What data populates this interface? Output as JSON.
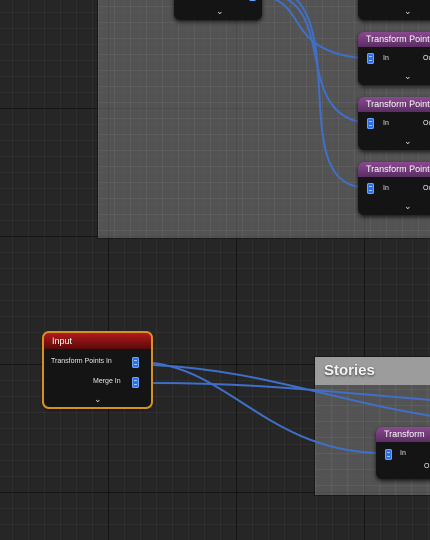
{
  "canvas": {
    "grid_color": "#262626",
    "wire_color": "#3f6fc8"
  },
  "top_comment": {
    "title": ""
  },
  "top_nodes": [
    {
      "title": "Transform Points",
      "in_label": "In",
      "out_label": "Ou",
      "color": "#7a3f80"
    },
    {
      "title": "Transform Points",
      "in_label": "In",
      "out_label": "Ou",
      "color": "#7a3f80"
    },
    {
      "title": "Transform Points",
      "in_label": "In",
      "out_label": "Ou",
      "color": "#7a3f80"
    }
  ],
  "input_node": {
    "title": "Input",
    "pins": [
      {
        "label": "Transform Points In"
      },
      {
        "label": "Merge In"
      }
    ],
    "title_color": "#a11a1a",
    "border_color": "#d8911f"
  },
  "stories_comment": {
    "title": "Stories"
  },
  "stories_node": {
    "title": "Transform",
    "in_label": "In",
    "out_label": "O"
  }
}
